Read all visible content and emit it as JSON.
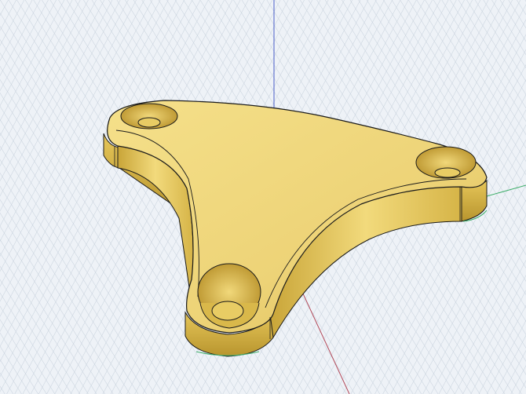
{
  "viewport": {
    "background_color": "#eef2f7",
    "grid_color": "#c4ced9",
    "axis_vertical_color": "#4a5fc9",
    "axis_x_color": "#b34a5a",
    "axis_y_color": "#3fae6a",
    "model": {
      "shape": "three-lobed bracket with three counterbored mounting holes",
      "face_color": "#f0d97a",
      "side_color": "#d8b84a",
      "edge_color": "#1a1a1a"
    }
  }
}
